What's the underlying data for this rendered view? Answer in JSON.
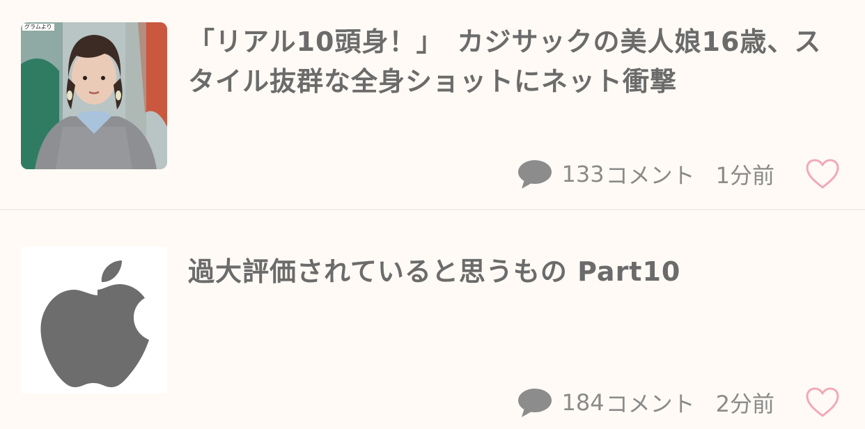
{
  "colors": {
    "background": "#fffaf5",
    "title_text": "#6b6b6b",
    "meta_text": "#8a8a8a",
    "comment_icon": "#8c8c8c",
    "heart_outline": "#f2a9b7"
  },
  "items": [
    {
      "thumbnail": {
        "type": "photo",
        "credit_label": "グラムより"
      },
      "title": "「リアル10頭身！」　カジサックの美人娘16歳、スタイル抜群な全身ショットにネット衝撃",
      "comment_icon": "speech-bubble-icon",
      "comments": "133",
      "comment_unit": "コメント",
      "time": "1分前",
      "favorite_icon": "heart-outline-icon"
    },
    {
      "thumbnail": {
        "type": "logo",
        "logo_name": "apple-logo-icon"
      },
      "title": "過大評価されていると思うもの Part10",
      "comment_icon": "speech-bubble-icon",
      "comments": "184",
      "comment_unit": "コメント",
      "time": "2分前",
      "favorite_icon": "heart-outline-icon"
    }
  ]
}
